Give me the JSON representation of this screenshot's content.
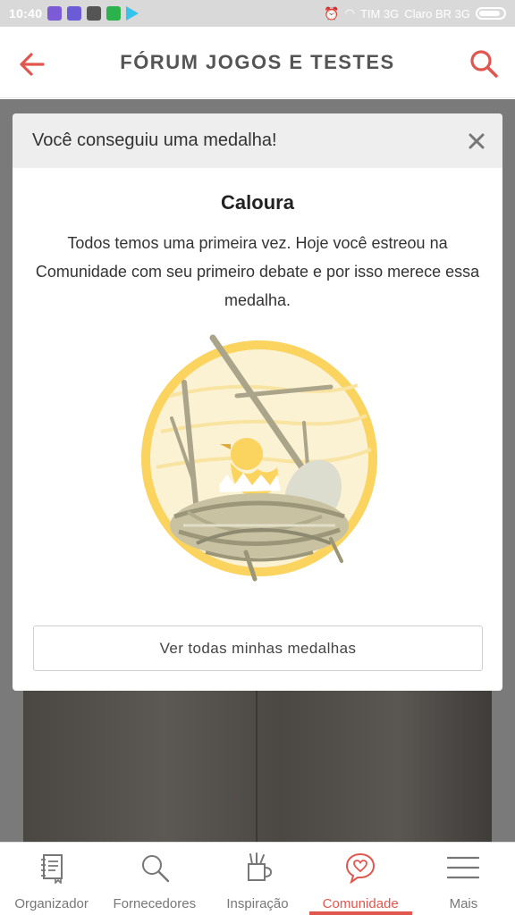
{
  "status_bar": {
    "time": "10:40",
    "carrier1": "TIM 3G",
    "carrier2": "Claro BR 3G"
  },
  "header": {
    "title": "FÓRUM JOGOS E TESTES",
    "accent_color": "#e0574f"
  },
  "modal": {
    "header_title": "Você conseguiu uma medalha!",
    "medal_name": "Caloura",
    "medal_description": "Todos temos uma primeira vez. Hoje você estreou na Comunidade com seu primeiro debate e por isso merece essa medalha.",
    "all_medals_button": "Ver todas minhas medalhas"
  },
  "bottom_nav": {
    "items": [
      {
        "label": "Organizador",
        "icon": "notebook-icon"
      },
      {
        "label": "Fornecedores",
        "icon": "search-icon"
      },
      {
        "label": "Inspiração",
        "icon": "brushes-icon"
      },
      {
        "label": "Comunidade",
        "icon": "heart-chat-icon",
        "active": true
      },
      {
        "label": "Mais",
        "icon": "menu-icon"
      }
    ]
  }
}
